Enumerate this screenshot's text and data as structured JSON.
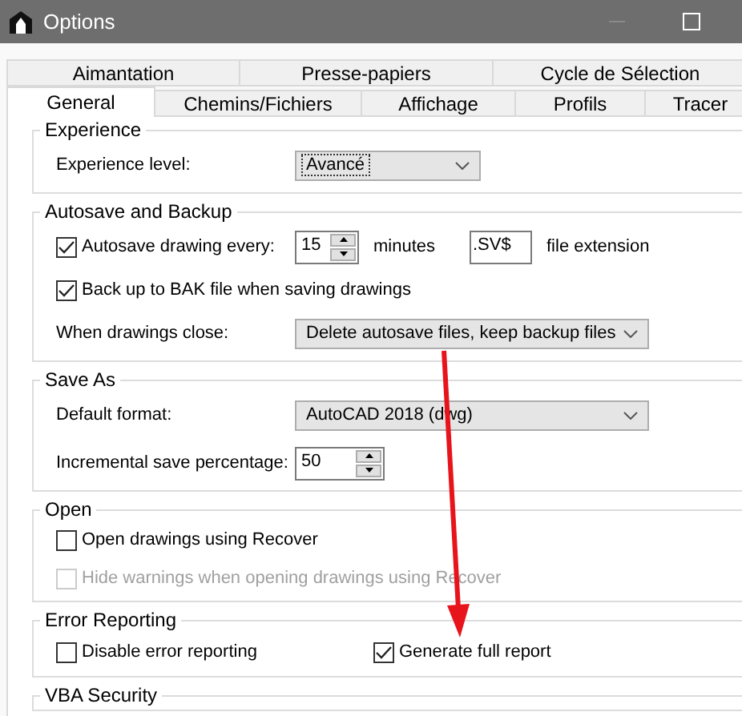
{
  "window": {
    "title": "Options"
  },
  "tab_rows": [
    {
      "tabs": [
        {
          "label": "Aimantation",
          "selected": false
        },
        {
          "label": "Presse-papiers",
          "selected": false
        },
        {
          "label": "Cycle de Sélection",
          "selected": false
        }
      ]
    },
    {
      "tabs": [
        {
          "label": "General",
          "selected": true
        },
        {
          "label": "Chemins/Fichiers",
          "selected": false
        },
        {
          "label": "Affichage",
          "selected": false
        },
        {
          "label": "Profils",
          "selected": false
        },
        {
          "label": "Tracer",
          "selected": false
        }
      ]
    }
  ],
  "groups": [
    {
      "title": "Experience",
      "rows": [
        {
          "kind": "field",
          "items": [
            {
              "kind": "label",
              "text": "Experience level:"
            },
            {
              "kind": "select",
              "value": "Avancé",
              "focused": true,
              "wide": false
            }
          ]
        }
      ]
    },
    {
      "title": "Autosave and Backup",
      "rows": [
        {
          "kind": "autosave",
          "items": [
            {
              "kind": "checkbox",
              "label": "Autosave drawing every:",
              "checked": true,
              "disabled": false
            },
            {
              "kind": "spinner",
              "value": "15"
            },
            {
              "kind": "label",
              "text": "minutes"
            },
            {
              "kind": "textfield",
              "value": ".SV$"
            },
            {
              "kind": "label",
              "text": "file extension"
            }
          ]
        },
        {
          "kind": "single",
          "items": [
            {
              "kind": "checkbox",
              "label": "Back up to BAK file when saving drawings",
              "checked": true,
              "disabled": false
            }
          ]
        },
        {
          "kind": "field",
          "items": [
            {
              "kind": "label",
              "text": "When drawings close:"
            },
            {
              "kind": "select",
              "value": "Delete autosave files, keep backup files",
              "focused": false,
              "wide": true
            }
          ]
        }
      ]
    },
    {
      "title": "Save As",
      "rows": [
        {
          "kind": "field",
          "items": [
            {
              "kind": "label",
              "text": "Default format:"
            },
            {
              "kind": "select",
              "value": "AutoCAD 2018 (dwg)",
              "focused": false,
              "wide": true
            }
          ]
        },
        {
          "kind": "field",
          "items": [
            {
              "kind": "label",
              "text": "Incremental save percentage:"
            },
            {
              "kind": "spinner",
              "value": "50"
            }
          ]
        }
      ]
    },
    {
      "title": "Open",
      "rows": [
        {
          "kind": "single",
          "items": [
            {
              "kind": "checkbox",
              "label": "Open drawings using Recover",
              "checked": false,
              "disabled": false
            }
          ]
        },
        {
          "kind": "single",
          "items": [
            {
              "kind": "checkbox",
              "label": "Hide warnings when opening drawings using Recover",
              "checked": false,
              "disabled": true
            }
          ]
        }
      ]
    },
    {
      "title": "Error Reporting",
      "rows": [
        {
          "kind": "pair",
          "items": [
            {
              "kind": "checkbox",
              "label": "Disable error reporting",
              "checked": false,
              "disabled": false
            },
            {
              "kind": "checkbox",
              "label": "Generate full report",
              "checked": true,
              "disabled": false
            }
          ]
        }
      ]
    },
    {
      "title": "VBA Security"
    }
  ],
  "annotation": {
    "kind": "arrow"
  }
}
